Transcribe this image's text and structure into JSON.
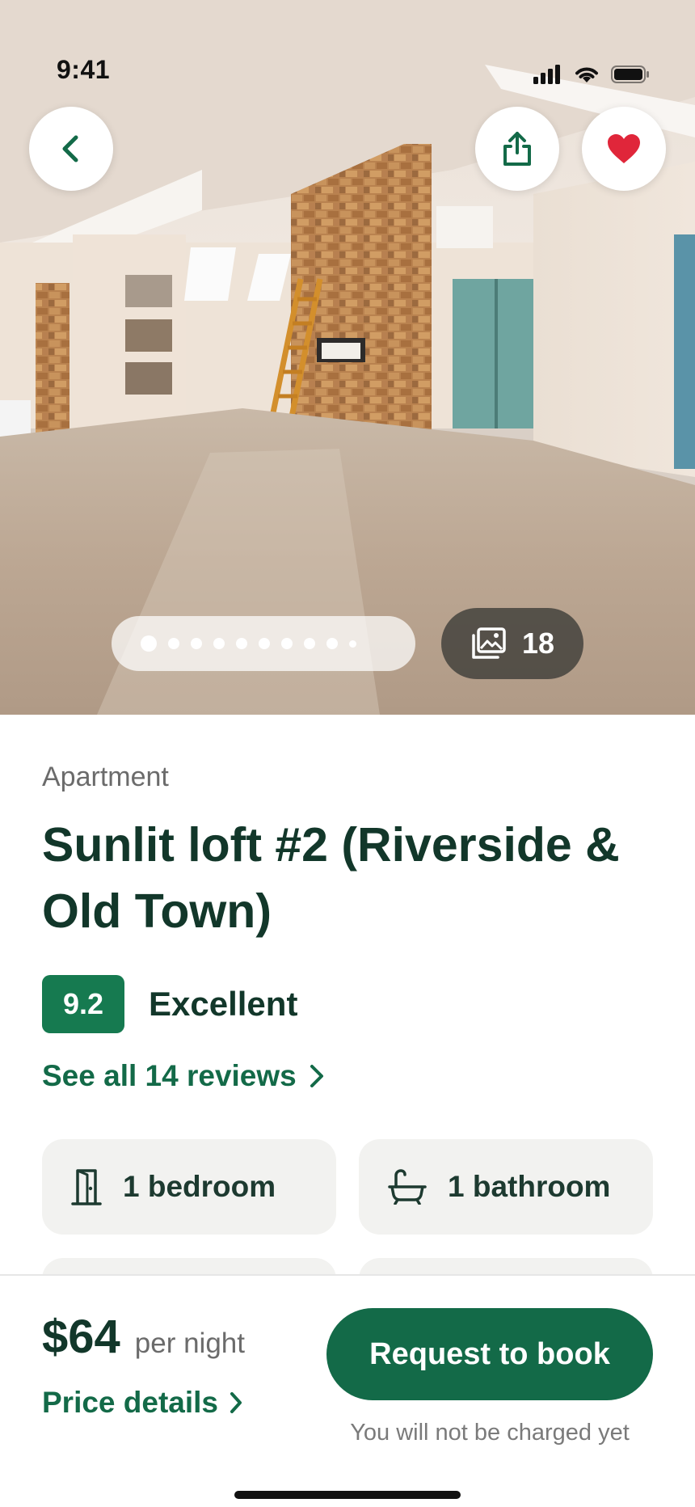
{
  "status_bar": {
    "time": "9:41",
    "icons": [
      "signal-icon",
      "wifi-icon",
      "battery-icon"
    ]
  },
  "hero": {
    "photo_description_icon": "room-photo",
    "back_icon": "chevron-left-icon",
    "share_icon": "share-icon",
    "favorite_icon": "heart-icon",
    "favorite_color": "#e0263a",
    "carousel": {
      "total_dots": 10,
      "active_index": 0
    },
    "photo_count": "18",
    "photo_count_icon": "gallery-icon"
  },
  "listing": {
    "type": "Apartment",
    "title": "Sunlit loft #2 (Riverside & Old Town)",
    "rating_score": "9.2",
    "rating_label": "Excellent",
    "reviews_link": "See all 14 reviews"
  },
  "features": [
    {
      "icon": "door-icon",
      "label": "1 bedroom"
    },
    {
      "icon": "bathtub-icon",
      "label": "1 bathroom"
    }
  ],
  "booking": {
    "price": "$64",
    "price_unit": "per night",
    "price_details_link": "Price details",
    "book_button": "Request to book",
    "note": "You will not be charged yet"
  },
  "colors": {
    "brand_green": "#136a48",
    "rating_green": "#167a50",
    "title_dark": "#12372a"
  }
}
